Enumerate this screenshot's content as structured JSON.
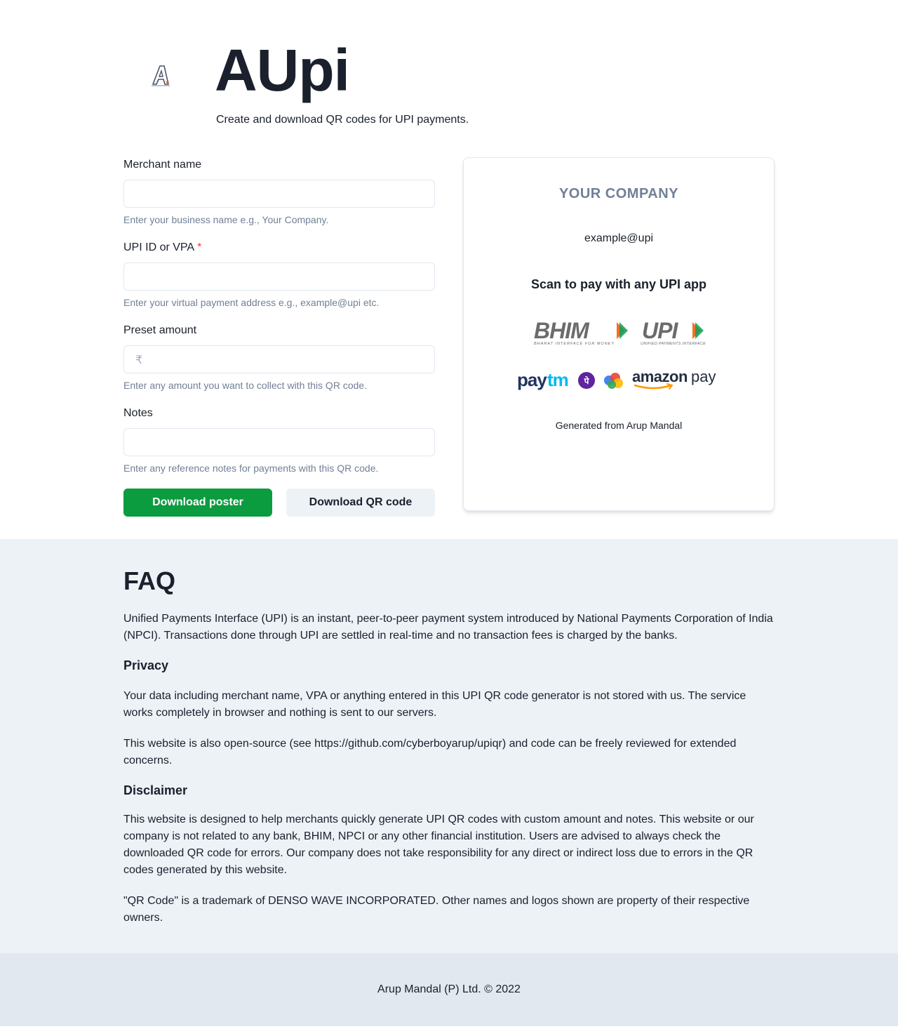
{
  "header": {
    "title": "AUpi",
    "subtitle": "Create and download QR codes for UPI payments.",
    "logo_icon": "aupi-logo-icon"
  },
  "form": {
    "merchant": {
      "label": "Merchant name",
      "value": "",
      "placeholder": "",
      "helper": "Enter your business name e.g., Your Company."
    },
    "vpa": {
      "label": "UPI ID or VPA",
      "required_mark": "*",
      "value": "",
      "placeholder": "",
      "helper": "Enter your virtual payment address e.g., example@upi etc."
    },
    "amount": {
      "label": "Preset amount",
      "prefix": "₹",
      "value": "",
      "placeholder": "",
      "helper": "Enter any amount you want to collect with this QR code."
    },
    "notes": {
      "label": "Notes",
      "value": "",
      "placeholder": "",
      "helper": "Enter any reference notes for payments with this QR code."
    },
    "download_poster_label": "Download poster",
    "download_qr_label": "Download QR code"
  },
  "poster": {
    "company": "YOUR COMPANY",
    "vpa": "example@upi",
    "scan_text": "Scan to pay with any UPI app",
    "logos_row1": [
      "bhim-logo",
      "upi-logo"
    ],
    "bhim_text": "BHIM",
    "bhim_tagline": "BHARAT INTERFACE FOR MONEY",
    "upi_text": "UPI",
    "upi_tagline": "UNIFIED PAYMENTS INTERFACE",
    "logos_row2": [
      "paytm-logo",
      "phonepe-logo",
      "googlepay-logo",
      "amazonpay-logo"
    ],
    "paytm_text_a": "pay",
    "paytm_text_b": "tm",
    "phonepe_glyph": "पे",
    "amazon_text": "amazon",
    "amazon_pay_text": "pay",
    "generated": "Generated from Arup Mandal"
  },
  "faq": {
    "title": "FAQ",
    "intro": "Unified Payments Interface (UPI) is an instant, peer-to-peer payment system introduced by National Payments Corporation of India (NPCI). Transactions done through UPI are settled in real-time and no transaction fees is charged by the banks.",
    "privacy_heading": "Privacy",
    "privacy_p1": "Your data including merchant name, VPA or anything entered in this UPI QR code generator is not stored with us. The service works completely in browser and nothing is sent to our servers.",
    "privacy_p2": "This website is also open-source (see https://github.com/cyberboyarup/upiqr) and code can be freely reviewed for extended concerns.",
    "disclaimer_heading": "Disclaimer",
    "disclaimer_p1": "This website is designed to help merchants quickly generate UPI QR codes with custom amount and notes. This website or our company is not related to any bank, BHIM, NPCI or any other financial institution. Users are advised to always check the downloaded QR code for errors. Our company does not take responsibility for any direct or indirect loss due to errors in the QR codes generated by this website.",
    "disclaimer_p2": "\"QR Code\" is a trademark of DENSO WAVE INCORPORATED. Other names and logos shown are property of their respective owners."
  },
  "footer": {
    "text": "Arup Mandal (P) Ltd. © 2022"
  },
  "colors": {
    "primary_button": "#0b9c3f",
    "secondary_button": "#edf2f7",
    "faq_background": "#edf2f7",
    "footer_background": "#e2e8f0",
    "required": "#e53e3e",
    "helper_text": "#718096"
  }
}
